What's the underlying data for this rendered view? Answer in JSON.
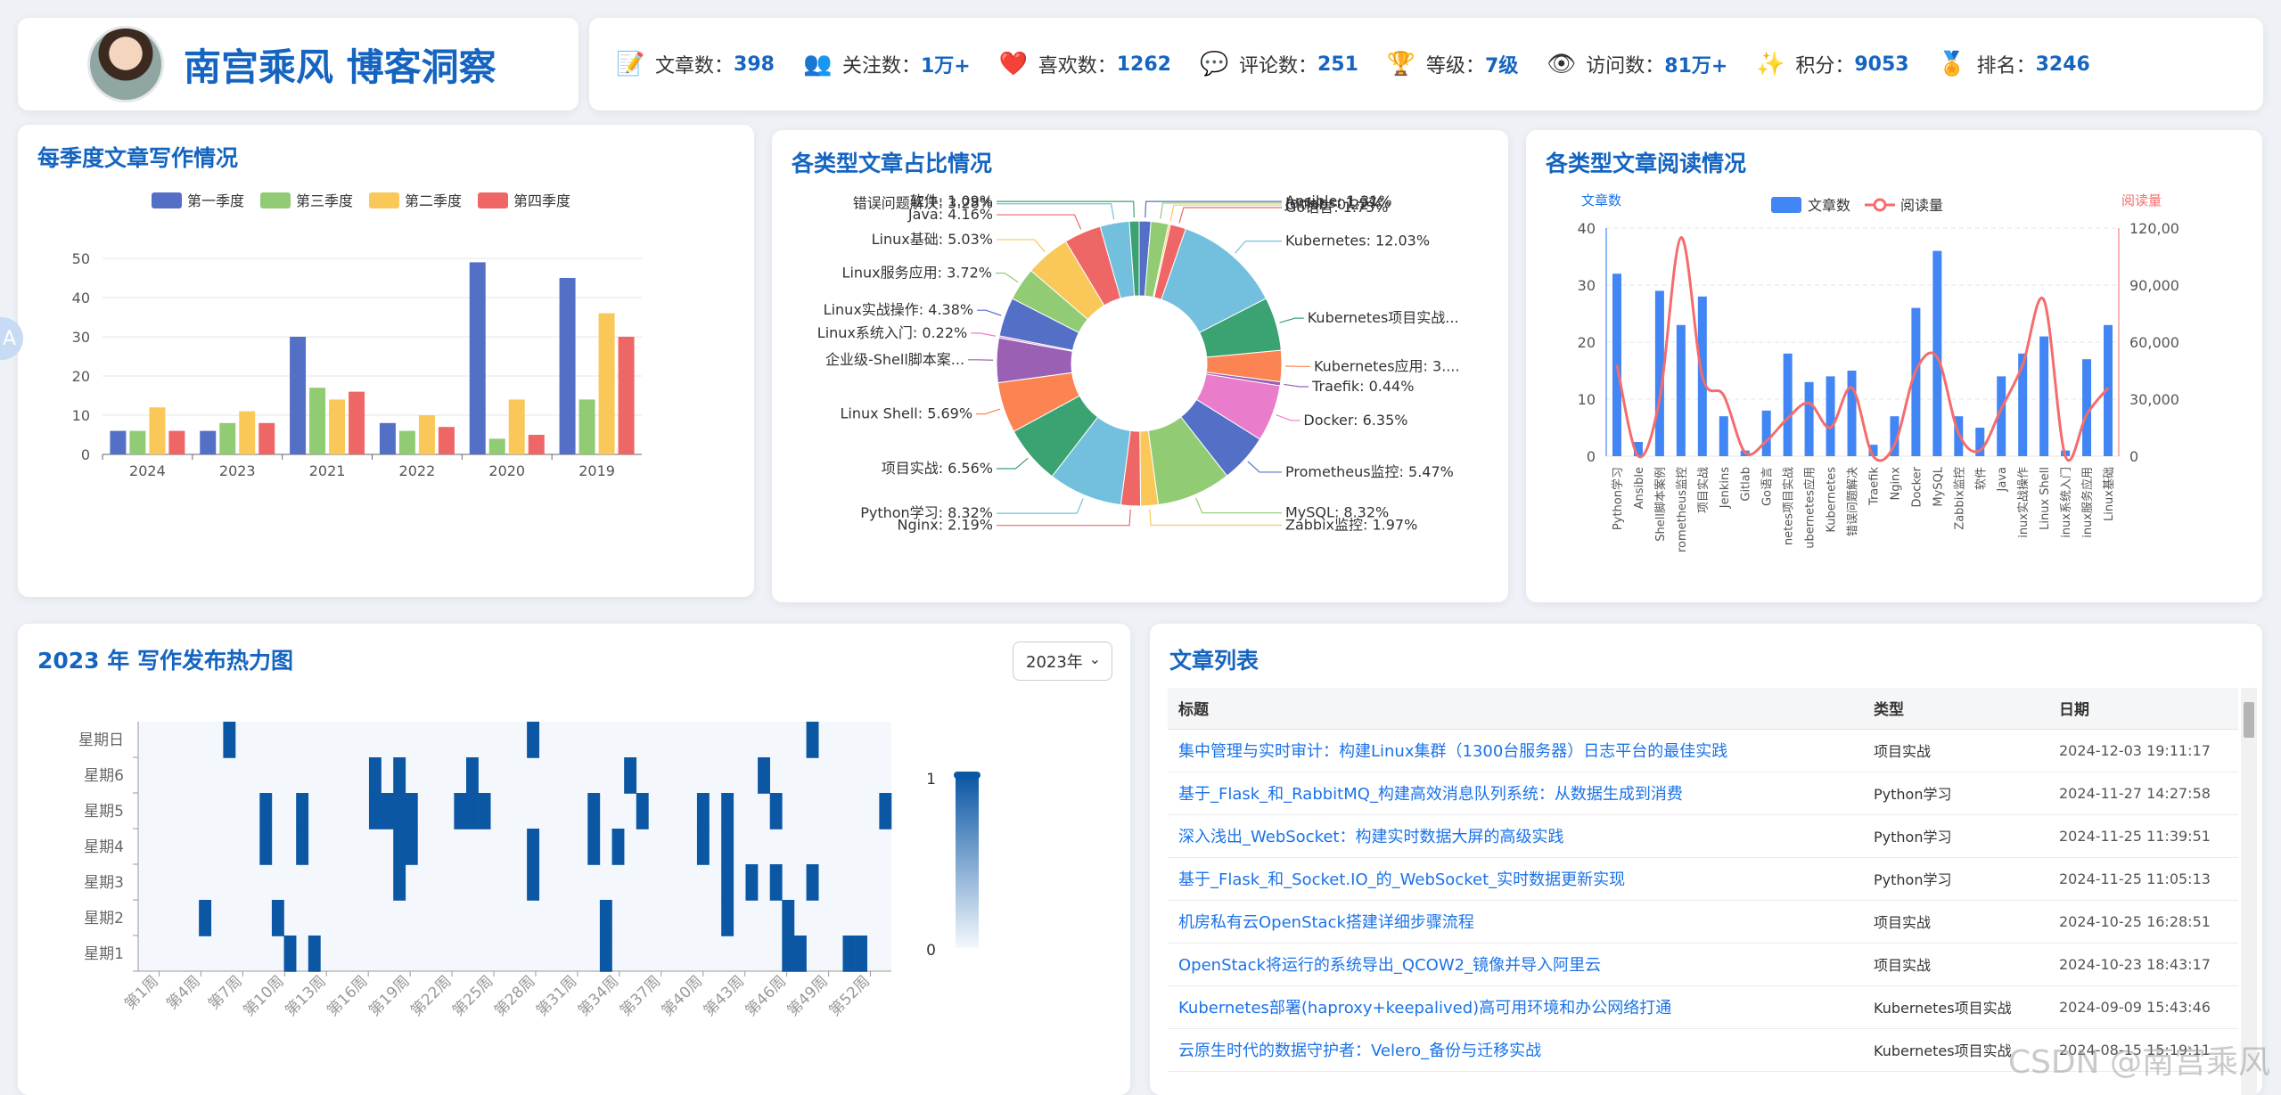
{
  "brand": {
    "title": "南宫乘风 博客洞察"
  },
  "stats": [
    {
      "icon": "📝",
      "icon_name": "memo-icon",
      "label": "文章数：",
      "value": "398"
    },
    {
      "icon": "👥",
      "icon_name": "followers-icon",
      "label": "关注数：",
      "value": "1万+"
    },
    {
      "icon": "❤️",
      "icon_name": "heart-icon",
      "label": "喜欢数：",
      "value": "1262"
    },
    {
      "icon": "💬",
      "icon_name": "comment-icon",
      "label": "评论数：",
      "value": "251"
    },
    {
      "icon": "🏆",
      "icon_name": "trophy-icon",
      "label": "等级：",
      "value": "7级"
    },
    {
      "icon": "👁",
      "icon_name": "eye-icon",
      "label": "访问数：",
      "value": "81万+"
    },
    {
      "icon": "✨",
      "icon_name": "sparkle-icon",
      "label": "积分：",
      "value": "9053"
    },
    {
      "icon": "🏅",
      "icon_name": "medal-icon",
      "label": "排名：",
      "value": "3246"
    }
  ],
  "quarterly": {
    "title": "每季度文章写作情况"
  },
  "types": {
    "title": "各类型文章占比情况"
  },
  "reads": {
    "title": "各类型文章阅读情况"
  },
  "heatmap": {
    "title": "2023 年 写作发布热力图",
    "year_selected": "2023年"
  },
  "articles": {
    "title": "文章列表",
    "headers": [
      "标题",
      "类型",
      "日期"
    ],
    "rows": [
      {
        "title": "集中管理与实时审计：构建Linux集群（1300台服务器）日志平台的最佳实践",
        "type": "项目实战",
        "date": "2024-12-03 19:11:17"
      },
      {
        "title": "基于_Flask_和_RabbitMQ_构建高效消息队列系统：从数据生成到消费",
        "type": "Python学习",
        "date": "2024-11-27 14:27:58"
      },
      {
        "title": "深入浅出_WebSocket：构建实时数据大屏的高级实践",
        "type": "Python学习",
        "date": "2024-11-25 11:39:51"
      },
      {
        "title": "基于_Flask_和_Socket.IO_的_WebSocket_实时数据更新实现",
        "type": "Python学习",
        "date": "2024-11-25 11:05:13"
      },
      {
        "title": "机房私有云OpenStack搭建详细步骤流程",
        "type": "项目实战",
        "date": "2024-10-25 16:28:51"
      },
      {
        "title": "OpenStack将运行的系统导出_QCOW2_镜像并导入阿里云",
        "type": "项目实战",
        "date": "2024-10-23 18:43:17"
      },
      {
        "title": "Kubernetes部署(haproxy+keepalived)高可用环境和办公网络打通",
        "type": "Kubernetes项目实战",
        "date": "2024-09-09 15:43:46"
      },
      {
        "title": "云原生时代的数据守护者：Velero_备份与迁移实战",
        "type": "Kubernetes项目实战",
        "date": "2024-08-15 15:19:11"
      }
    ]
  },
  "watermark": "CSDN @南宫乘风",
  "colors": {
    "accent": "#1565c0",
    "link": "#1a73e8",
    "q1": "#5470c6",
    "q3": "#91cc75",
    "q2": "#fac858",
    "q4": "#ee6666",
    "bar": "#4285f4",
    "line": "#f56c6c",
    "heat": "#0b57a4"
  },
  "chart_data": [
    {
      "type": "bar",
      "categories": [
        "2024",
        "2023",
        "2021",
        "2022",
        "2020",
        "2019"
      ],
      "series": [
        {
          "name": "第一季度",
          "values": [
            6,
            6,
            30,
            8,
            49,
            45
          ]
        },
        {
          "name": "第三季度",
          "values": [
            6,
            8,
            17,
            6,
            4,
            14
          ]
        },
        {
          "name": "第二季度",
          "values": [
            12,
            11,
            14,
            10,
            14,
            36
          ]
        },
        {
          "name": "第四季度",
          "values": [
            6,
            8,
            16,
            7,
            5,
            30
          ]
        }
      ],
      "ylim": [
        0,
        50
      ],
      "yticks": [
        0,
        10,
        20,
        30,
        40,
        50
      ],
      "legend": "top-center"
    },
    {
      "type": "pie",
      "slices": [
        {
          "label": "Ansible",
          "value": 1.31,
          "color": "#5470c6"
        },
        {
          "label": "Jenkins",
          "value": 1.97,
          "color": "#91cc75"
        },
        {
          "label": "Gitlab",
          "value": 0.22,
          "color": "#fac858"
        },
        {
          "label": "Go语言",
          "value": 1.75,
          "color": "#ee6666"
        },
        {
          "label": "Kubernetes",
          "value": 12.03,
          "color": "#73c0de"
        },
        {
          "label": "Kubernetes项目实战...",
          "value": 6.0,
          "color": "#3ba272"
        },
        {
          "label": "Kubernetes应用: 3....",
          "value": 3.5,
          "color": "#fc8452"
        },
        {
          "label": "Traefik",
          "value": 0.44,
          "color": "#9a60b4"
        },
        {
          "label": "Docker",
          "value": 6.35,
          "color": "#ea7ccc"
        },
        {
          "label": "Prometheus监控",
          "value": 5.47,
          "color": "#5470c6"
        },
        {
          "label": "MySQL",
          "value": 8.32,
          "color": "#91cc75"
        },
        {
          "label": "Zabbix监控",
          "value": 1.97,
          "color": "#fac858"
        },
        {
          "label": "Nginx",
          "value": 2.19,
          "color": "#ee6666"
        },
        {
          "label": "Python学习",
          "value": 8.32,
          "color": "#73c0de"
        },
        {
          "label": "项目实战",
          "value": 6.56,
          "color": "#3ba272"
        },
        {
          "label": "Linux Shell",
          "value": 5.69,
          "color": "#fc8452"
        },
        {
          "label": "企业级-Shell脚本案...",
          "value": 5.0,
          "color": "#9a60b4"
        },
        {
          "label": "Linux系统入门",
          "value": 0.22,
          "color": "#ea7ccc"
        },
        {
          "label": "Linux实战操作",
          "value": 4.38,
          "color": "#5470c6"
        },
        {
          "label": "Linux服务应用",
          "value": 3.72,
          "color": "#91cc75"
        },
        {
          "label": "Linux基础",
          "value": 5.03,
          "color": "#fac858"
        },
        {
          "label": "Java",
          "value": 4.16,
          "color": "#ee6666"
        },
        {
          "label": "错误问题解决",
          "value": 3.28,
          "color": "#73c0de"
        },
        {
          "label": "软件",
          "value": 1.09,
          "color": "#3ba272"
        }
      ],
      "labels_text": [
        "Ansible: 1.31%",
        "Jenkins: 1.97%",
        "Gitlab: 0.22%",
        "Go语言: 1.75%",
        "Kubernetes: 12.03%",
        "Kubernetes项目实战...",
        "Kubernetes应用: 3....",
        "Traefik: 0.44%",
        "Docker: 6.35%",
        "Prometheus监控: 5.47%",
        "MySQL: 8.32%",
        "Zabbix监控: 1.97%",
        "Nginx: 2.19%",
        "Python学习: 8.32%",
        "项目实战: 6.56%",
        "Linux Shell: 5.69%",
        "企业级-Shell脚本案...",
        "Linux系统入门: 0.22%",
        "Linux实战操作: 4.38%",
        "Linux服务应用: 3.72%",
        "Linux基础: 5.03%",
        "Java: 4.16%",
        "错误问题解决: 3.28%",
        "软件: 1.09%"
      ]
    },
    {
      "type": "bar",
      "categories": [
        "Python学习",
        "Ansible",
        "企业级-Shell脚本案例",
        "Prometheus监控",
        "项目实战",
        "Jenkins",
        "Gitlab",
        "Go语言",
        "Kubernetes项目实战",
        "Kubernetes应用",
        "Kubernetes",
        "错误问题解决",
        "Traefik",
        "Nginx",
        "Docker",
        "MySQL",
        "Zabbix监控",
        "软件",
        "Java",
        "Linux实战操作",
        "Linux Shell",
        "Linux系统入门",
        "Linux服务应用",
        "Linux基础"
      ],
      "tick_labels": [
        "Python学习",
        "Ansible",
        "Shell脚本案例",
        "rometheus监控",
        "项目实战",
        "Jenkins",
        "Gitlab",
        "Go语言",
        "netes项目实战",
        "ubernetes应用",
        "Kubernetes",
        "错误问题解决",
        "Traefik",
        "Nginx",
        "Docker",
        "MySQL",
        "Zabbix监控",
        "软件",
        "Java",
        "inux实战操作",
        "Linux Shell",
        "inux系统入门",
        "inux服务应用",
        "Linux基础"
      ],
      "series": [
        {
          "name": "文章数",
          "type": "bar",
          "axis": "left",
          "values": [
            32,
            2.5,
            29,
            23,
            28,
            7,
            1,
            8,
            18,
            13,
            14,
            15,
            2,
            7,
            26,
            36,
            7,
            5,
            14,
            18,
            21,
            1,
            17,
            23
          ]
        },
        {
          "name": "阅读量",
          "type": "line",
          "axis": "right",
          "values": [
            48000,
            0,
            30000,
            115000,
            42000,
            32000,
            2000,
            8000,
            20000,
            28000,
            15000,
            36000,
            0,
            6000,
            45000,
            52000,
            12000,
            3000,
            25000,
            48000,
            82000,
            0,
            22000,
            36000
          ]
        }
      ],
      "ylabel_left": "文章数",
      "ylabel_right": "阅读量",
      "ylim_left": [
        0,
        40
      ],
      "ylim_right": [
        0,
        120000
      ],
      "yticks_left": [
        0,
        10,
        20,
        30,
        40
      ],
      "yticks_right": [
        "0",
        "30,000",
        "60,000",
        "90,000",
        "120,00"
      ],
      "legend": "top-center"
    },
    {
      "type": "heatmap",
      "x_tick_labels": [
        "第1周",
        "第4周",
        "第7周",
        "第10周",
        "第13周",
        "第16周",
        "第19周",
        "第22周",
        "第25周",
        "第28周",
        "第31周",
        "第34周",
        "第37周",
        "第40周",
        "第43周",
        "第46周",
        "第49周",
        "第52周"
      ],
      "y_categories": [
        "星期1",
        "星期2",
        "星期3",
        "星期4",
        "星期5",
        "星期6",
        "星期日"
      ],
      "value_range": [
        0,
        1
      ],
      "visual_map_labels": [
        "1",
        "0"
      ],
      "cells": [
        [
          7,
          6
        ],
        [
          5,
          1
        ],
        [
          10,
          3
        ],
        [
          10,
          4
        ],
        [
          11,
          1
        ],
        [
          12,
          0
        ],
        [
          13,
          3
        ],
        [
          13,
          4
        ],
        [
          14,
          0
        ],
        [
          19,
          4
        ],
        [
          19,
          5
        ],
        [
          20,
          4
        ],
        [
          21,
          2
        ],
        [
          21,
          3
        ],
        [
          21,
          4
        ],
        [
          21,
          5
        ],
        [
          22,
          3
        ],
        [
          22,
          4
        ],
        [
          26,
          4
        ],
        [
          27,
          5
        ],
        [
          27,
          4
        ],
        [
          28,
          4
        ],
        [
          32,
          2
        ],
        [
          32,
          3
        ],
        [
          32,
          6
        ],
        [
          37,
          3
        ],
        [
          37,
          4
        ],
        [
          38,
          1
        ],
        [
          38,
          0
        ],
        [
          39,
          3
        ],
        [
          40,
          5
        ],
        [
          41,
          4
        ],
        [
          46,
          3
        ],
        [
          46,
          4
        ],
        [
          48,
          3
        ],
        [
          48,
          4
        ],
        [
          50,
          2
        ],
        [
          51,
          5
        ],
        [
          52,
          2
        ],
        [
          52,
          4
        ],
        [
          53,
          1
        ],
        [
          53,
          0
        ],
        [
          54,
          0
        ],
        [
          55,
          6
        ],
        [
          55,
          2
        ],
        [
          58,
          0
        ],
        [
          59,
          0
        ],
        [
          61,
          4
        ],
        [
          48,
          1
        ],
        [
          48,
          2
        ]
      ]
    }
  ]
}
